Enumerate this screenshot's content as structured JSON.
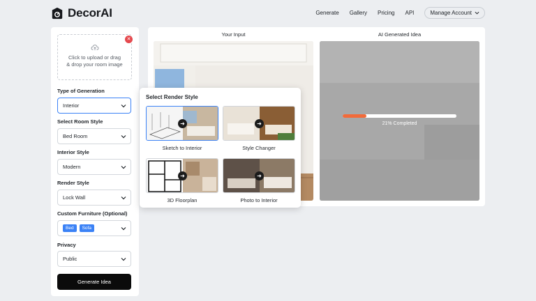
{
  "brand": {
    "name": "DecorAI"
  },
  "nav": {
    "items": [
      "Generate",
      "Gallery",
      "Pricing",
      "API"
    ],
    "account_label": "Manage Account"
  },
  "upload": {
    "line1": "Click to upload or drag",
    "line2": "& drop your room image"
  },
  "form": {
    "type_label": "Type of Generation",
    "type_value": "Interior",
    "room_label": "Select Room Style",
    "room_value": "Bed Room",
    "interior_label": "Interior Style",
    "interior_value": "Modern",
    "render_label": "Render Style",
    "render_value": "Lock Wall",
    "furniture_label": "Custom Furniture (Optional)",
    "furniture_chips": [
      "Bed",
      "Sofa"
    ],
    "privacy_label": "Privacy",
    "privacy_value": "Public",
    "generate_label": "Generate Idea"
  },
  "main": {
    "input_title": "Your Input",
    "output_title": "AI Generated Idea",
    "progress": 0.21,
    "progress_text": "21% Completed"
  },
  "popup": {
    "title": "Select Render Style",
    "options": [
      "Sketch to Interior",
      "Style Changer",
      "3D Floorplan",
      "Photo to Interior"
    ]
  },
  "colors": {
    "accent": "#3b82f6",
    "progress": "#f26b3a",
    "button": "#0b0b0b",
    "danger": "#e5484d"
  }
}
